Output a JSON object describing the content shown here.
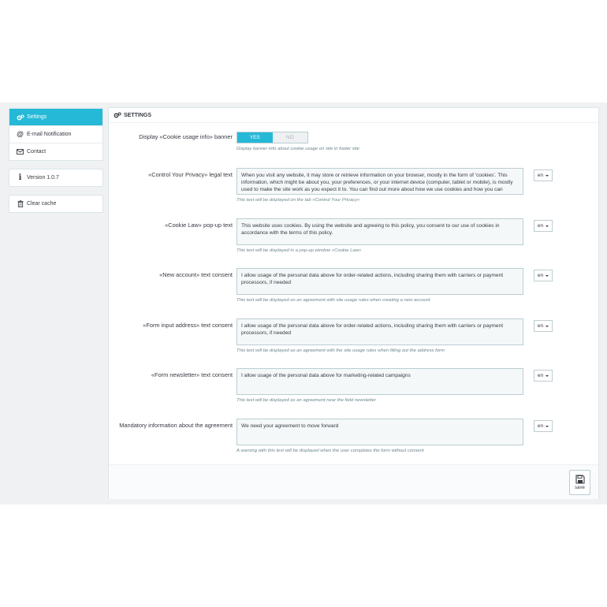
{
  "sidebar": {
    "items": [
      {
        "label": "Settings",
        "icon": "gears-icon"
      },
      {
        "label": "E-mail Notification",
        "icon": "at-icon"
      },
      {
        "label": "Contact",
        "icon": "envelope-icon"
      }
    ],
    "version": "Version 1.0.7",
    "clear_cache": "Clear cache"
  },
  "panel": {
    "title": "SETTINGS",
    "banner": {
      "label": "Display «Cookie usage info» banner",
      "yes": "YES",
      "no": "NO",
      "help": "Display banner info about cookie usage on site in footer site"
    },
    "fields": [
      {
        "label": "«Control Your Privacy» legal text",
        "value": "When you visit any website, it may store or retrieve information on your browser, mostly in the form of 'cookies'. This information, which might be about you, your preferences, or your internet device (computer, tablet or mobile), is mostly used to make the site work as you expect it to. You can find out more about how we use cookies and how you can manage your preferences.",
        "help": "This text will be displayed on the tab «Control Your Privacy»",
        "lang": "en"
      },
      {
        "label": "«Cookie Law» pop-up text",
        "value": "This website uses cookies. By using the website and agreeing to this policy, you consent to our use of cookies in accordance with the terms of this policy.",
        "help": "This text will be displayed in a pop-up window «Cookie Law»",
        "lang": "en"
      },
      {
        "label": "«New account» text consent",
        "value": "I allow usage of the personal data above for order-related actions, including sharing them with carriers or payment processors, if needed",
        "help": "This text will be displayed as an agreement with site usage rules when creating a new account",
        "lang": "en"
      },
      {
        "label": "«Form input address» text consent",
        "value": "I allow usage of the personal data above for order-related actions, including sharing them with carriers or payment processors, if needed",
        "help": "This text will be displayed as an agreement with the site usage rules when filling out the address form",
        "lang": "en"
      },
      {
        "label": "«Form newsletter» text consent",
        "value": "I allow usage of the personal data above for marketing-related campaigns",
        "help": "This text will be displayed as an agreement near the field newsletter",
        "lang": "en"
      },
      {
        "label": "Mandatory information about the agreement",
        "value": "We need your agreement to move forward",
        "help": "A warning with this text will be displayed when the user completes the form without consent",
        "lang": "en"
      }
    ],
    "save_label": "save"
  },
  "colors": {
    "accent": "#25b9d7",
    "background": "#eff1f2",
    "input_bg": "#f5f8f9",
    "border": "#bbcdd2"
  }
}
